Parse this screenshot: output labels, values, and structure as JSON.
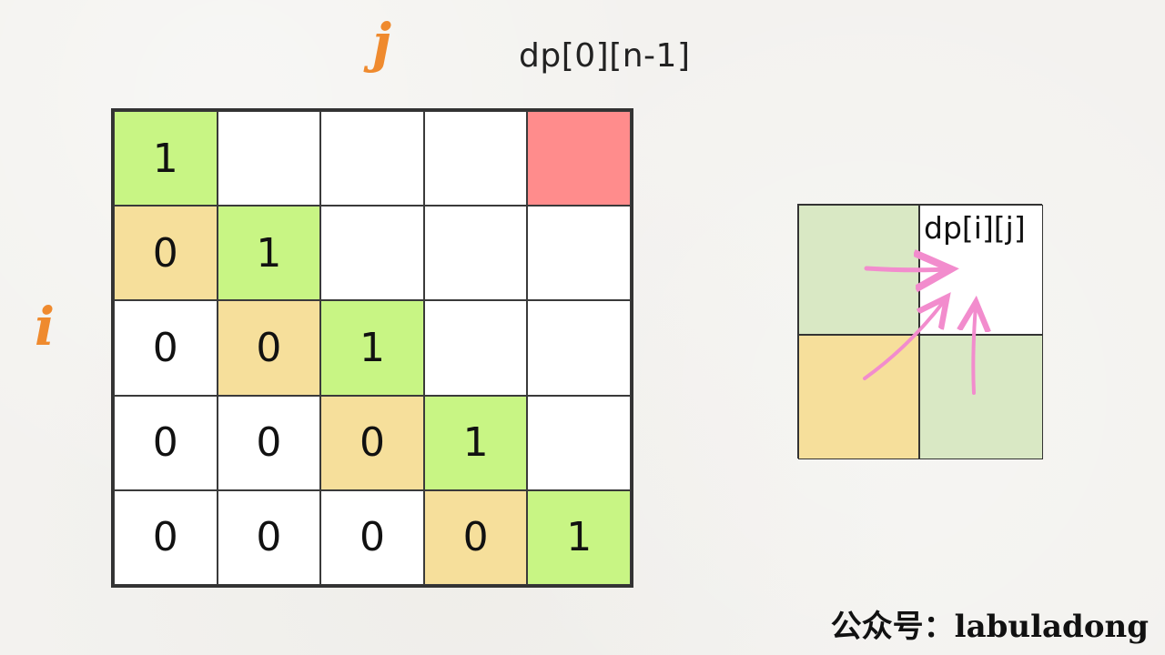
{
  "axis": {
    "row": "i",
    "col": "j"
  },
  "corner_label": "dp[0][n-1]",
  "grid": {
    "rows": [
      [
        {
          "v": "1",
          "c": "green"
        },
        {
          "v": "",
          "c": "white"
        },
        {
          "v": "",
          "c": "white"
        },
        {
          "v": "",
          "c": "white"
        },
        {
          "v": "",
          "c": "red"
        }
      ],
      [
        {
          "v": "0",
          "c": "yellow"
        },
        {
          "v": "1",
          "c": "green"
        },
        {
          "v": "",
          "c": "white"
        },
        {
          "v": "",
          "c": "white"
        },
        {
          "v": "",
          "c": "white"
        }
      ],
      [
        {
          "v": "0",
          "c": "white"
        },
        {
          "v": "0",
          "c": "yellow"
        },
        {
          "v": "1",
          "c": "green"
        },
        {
          "v": "",
          "c": "white"
        },
        {
          "v": "",
          "c": "white"
        }
      ],
      [
        {
          "v": "0",
          "c": "white"
        },
        {
          "v": "0",
          "c": "white"
        },
        {
          "v": "0",
          "c": "yellow"
        },
        {
          "v": "1",
          "c": "green"
        },
        {
          "v": "",
          "c": "white"
        }
      ],
      [
        {
          "v": "0",
          "c": "white"
        },
        {
          "v": "0",
          "c": "white"
        },
        {
          "v": "0",
          "c": "white"
        },
        {
          "v": "0",
          "c": "yellow"
        },
        {
          "v": "1",
          "c": "green"
        }
      ]
    ]
  },
  "mini": {
    "target_label": "dp[i][j]"
  },
  "colors": {
    "green": "#c8f584",
    "yellow": "#f6df9b",
    "red": "#ff8c8c",
    "light_green": "#d9e8c4",
    "arrow": "#f28ccd",
    "axis": "#ef8a2e"
  },
  "watermark": "公众号：labuladong"
}
